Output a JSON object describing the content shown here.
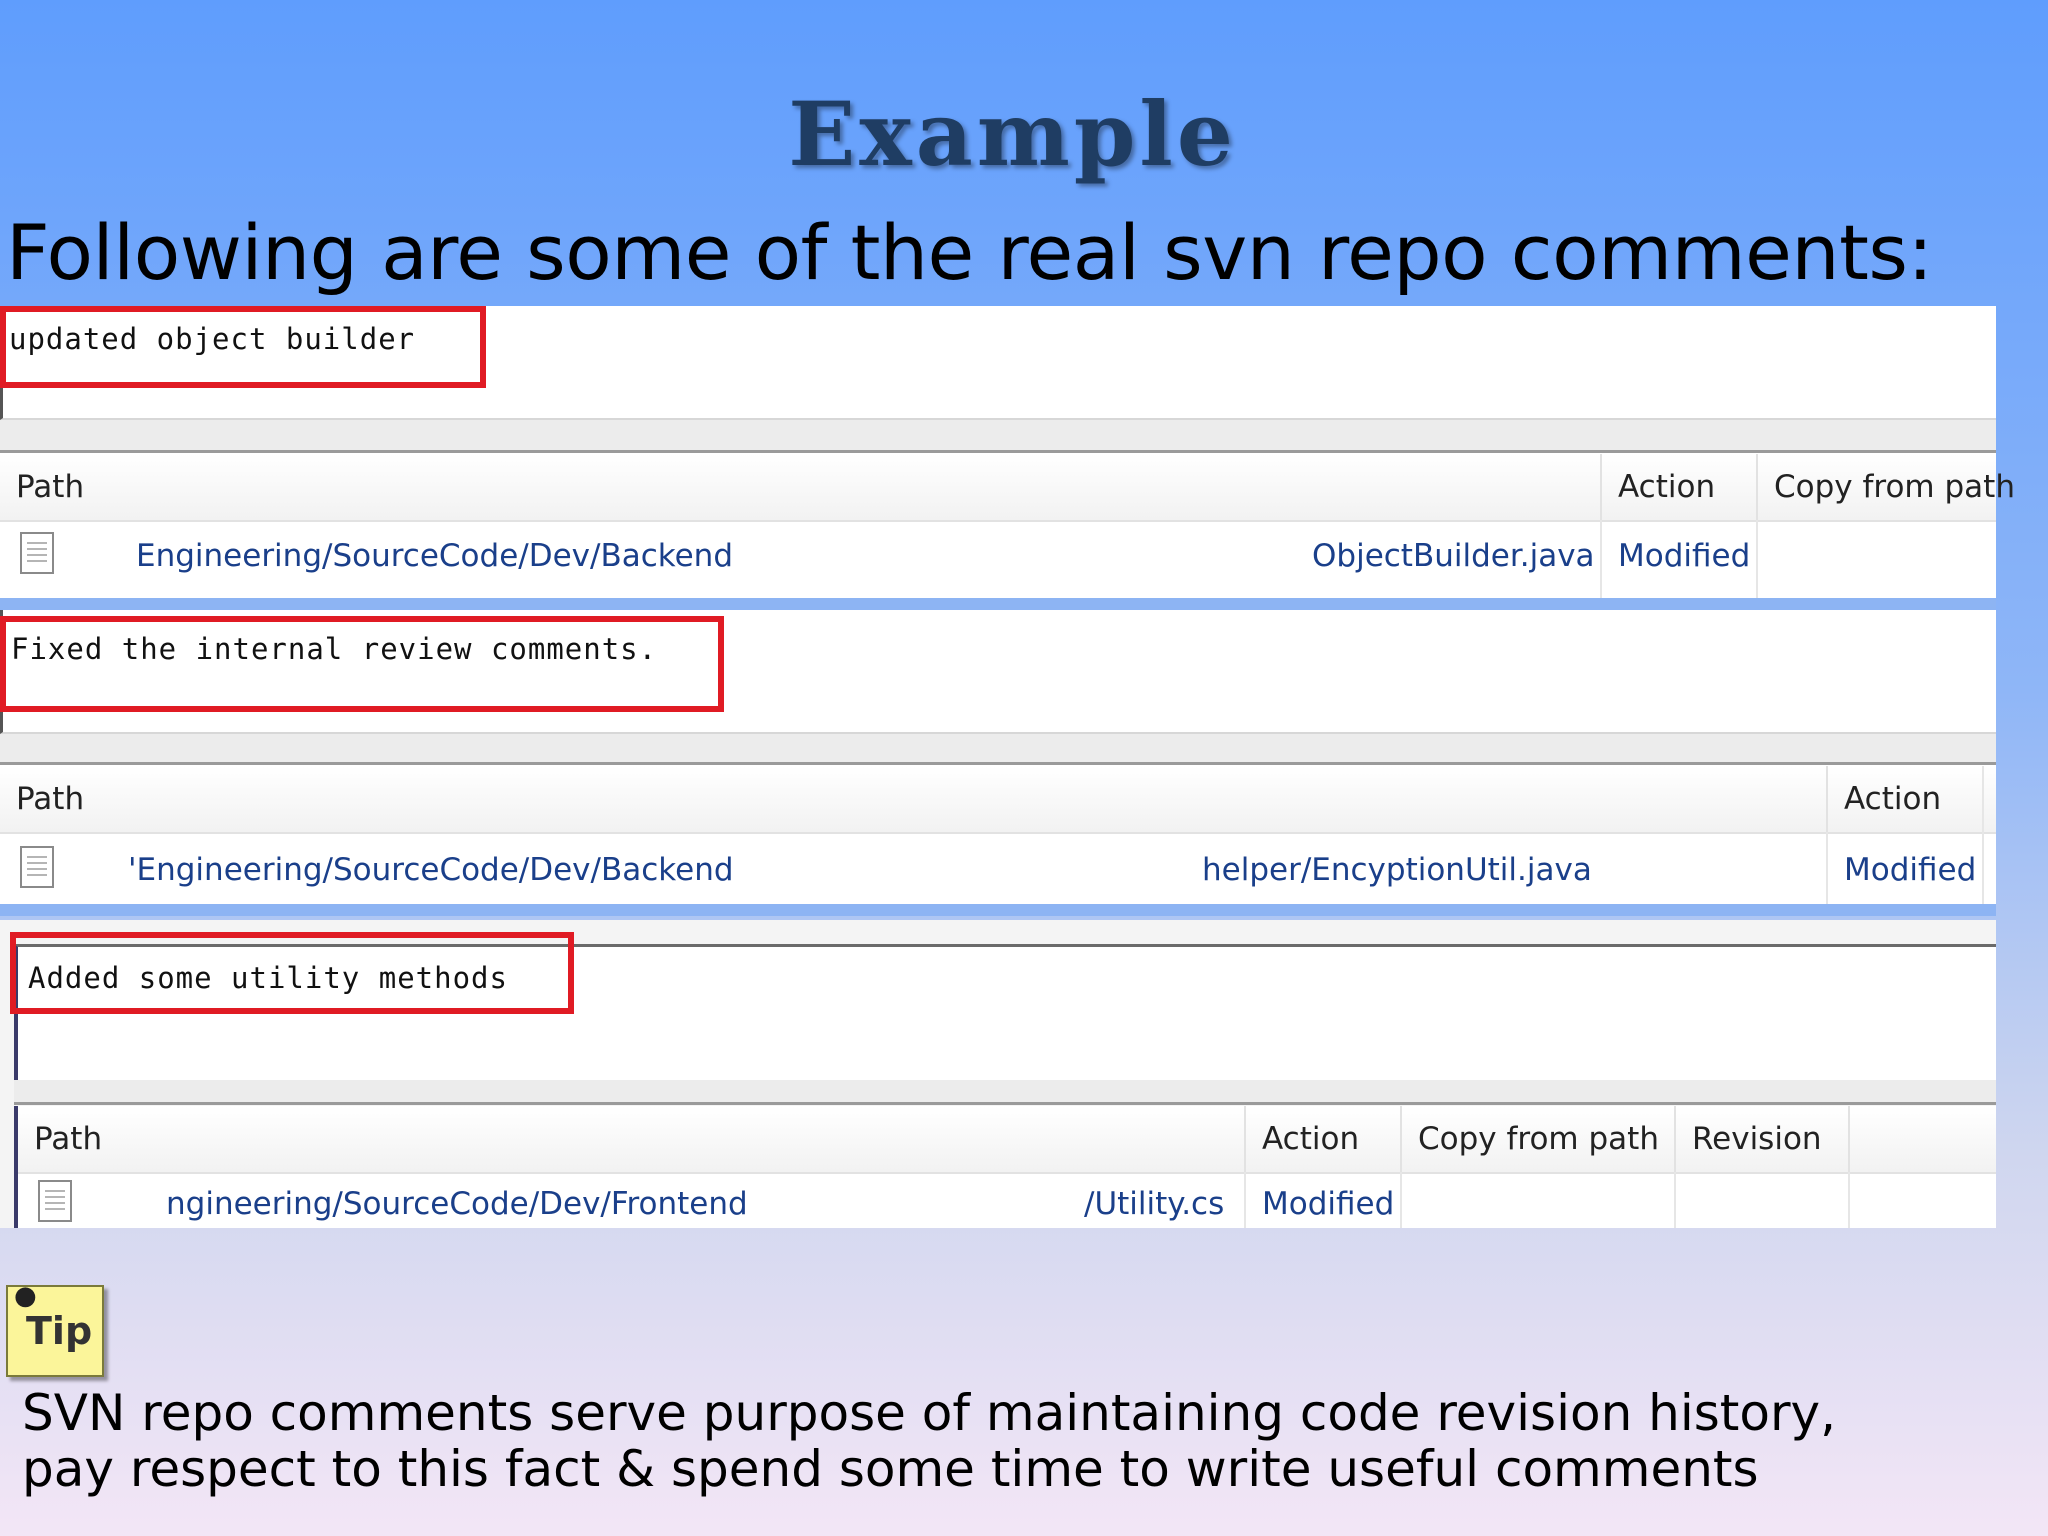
{
  "slide": {
    "title": "Example",
    "subtitle": "Following are some of the real svn repo comments:"
  },
  "commits": [
    {
      "comment": "updated object builder",
      "columns": [
        "Path",
        "Action",
        "Copy from path"
      ],
      "row": {
        "path_dir": "Engineering/SourceCode/Dev/Backend",
        "path_file": "ObjectBuilder.java",
        "action": "Modified"
      }
    },
    {
      "comment": "Fixed the internal review comments.",
      "columns": [
        "Path",
        "Action"
      ],
      "row": {
        "path_dir": "'Engineering/SourceCode/Dev/Backend",
        "path_file": "helper/EncyptionUtil.java",
        "action": "Modified"
      }
    },
    {
      "comment": "Added some utility methods",
      "columns": [
        "Path",
        "Action",
        "Copy from path",
        "Revision"
      ],
      "row": {
        "path_dir": "ngineering/SourceCode/Dev/Frontend",
        "path_file": "/Utility.cs",
        "action": "Modified"
      }
    }
  ],
  "tip": {
    "icon_label": "Tip",
    "icon": "tip-note-icon",
    "text": "SVN repo comments serve purpose of maintaining code revision history, pay respect to this fact & spend some time to write useful comments"
  },
  "colors": {
    "highlight_box": "#e01b24",
    "link_text": "#1a3f8a",
    "title": "#1f3d63"
  }
}
